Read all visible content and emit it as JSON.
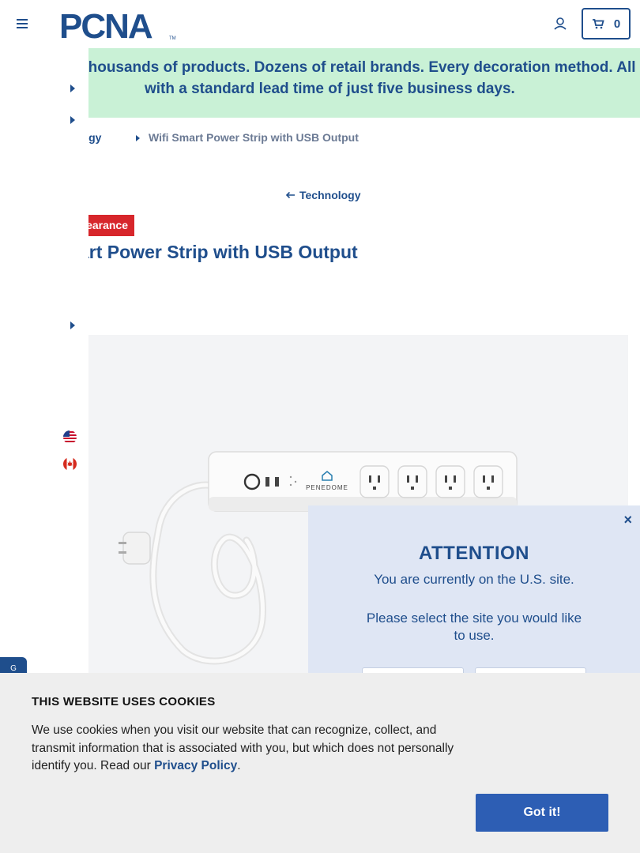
{
  "header": {
    "logo_text": "PCNA",
    "cart_count": "0"
  },
  "banner": {
    "line1": "Thousands of products. Dozens of retail brands. Every decoration method. All",
    "line2": "with a standard lead time of just five business days."
  },
  "breadcrumb": {
    "parent": "Technology",
    "parent_visible": "nnology",
    "current": "Wifi Smart Power Strip with USB Output"
  },
  "back_link": {
    "label": "Technology"
  },
  "product": {
    "badge": "Clearance",
    "badge_visible": "earance",
    "title_visible": "art Power Strip with USB Output",
    "image_brand": "PENEDOME"
  },
  "chat": {
    "label": "G"
  },
  "modal": {
    "close": "×",
    "title": "ATTENTION",
    "subtitle": "You are currently on the U.S. site.",
    "message": "Please select the site you would like to use."
  },
  "cookie": {
    "title": "THIS WEBSITE USES COOKIES",
    "text_before": "We use cookies when you visit our website that can recognize, collect, and transmit information that is associated with you, but which does not personally identify you. Read our ",
    "link": "Privacy Policy",
    "text_after": ".",
    "button": "Got it!"
  },
  "colors": {
    "brand_blue": "#1f4e8c",
    "banner_green": "#c9f1d6",
    "clearance_red": "#d7262b",
    "cookie_button": "#2d5eb4"
  }
}
